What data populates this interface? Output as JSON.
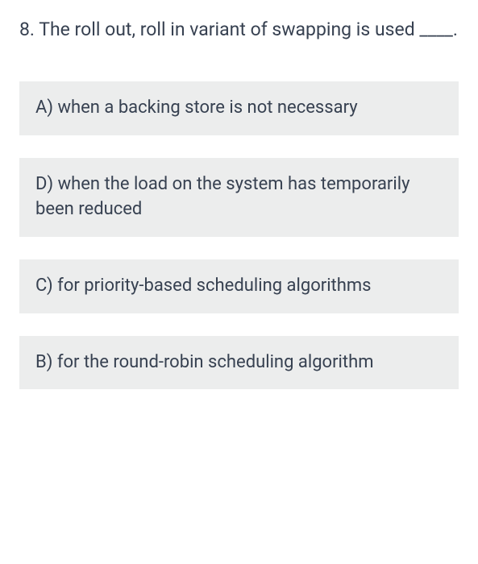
{
  "question": {
    "number": "8.",
    "text": "The roll out, roll in variant of swapping is used ____."
  },
  "options": [
    {
      "letter": "A)",
      "text": "when a backing store is not necessary"
    },
    {
      "letter": "D)",
      "text": "when the load on the system has temporarily been reduced"
    },
    {
      "letter": "C)",
      "text": "for priority-based scheduling algorithms"
    },
    {
      "letter": "B)",
      "text": "for the round-robin scheduling algorithm"
    }
  ]
}
